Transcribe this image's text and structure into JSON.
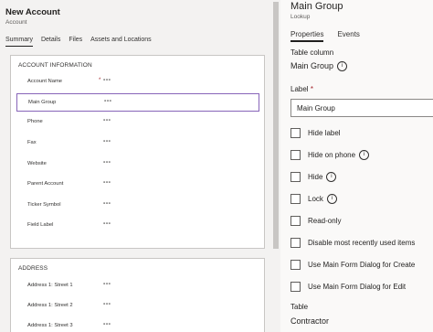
{
  "form": {
    "title": "New Account",
    "entity": "Account",
    "tabs": [
      "Summary",
      "Details",
      "Files",
      "Assets and Locations"
    ],
    "sections": [
      {
        "title": "ACCOUNT INFORMATION",
        "fields": [
          {
            "label": "Account Name",
            "required_mark": "*",
            "value": "---"
          },
          {
            "label": "Main Group",
            "value": "---"
          },
          {
            "label": "Phone",
            "value": "---"
          },
          {
            "label": "Fax",
            "value": "---"
          },
          {
            "label": "Website",
            "value": "---"
          },
          {
            "label": "Parent Account",
            "value": "---"
          },
          {
            "label": "Ticker Symbol",
            "value": "---"
          },
          {
            "label": "Field Label",
            "value": "---"
          }
        ]
      },
      {
        "title": "ADDRESS",
        "fields": [
          {
            "label": "Address 1: Street 1",
            "value": "---"
          },
          {
            "label": "Address 1: Street 2",
            "value": "---"
          },
          {
            "label": "Address 1: Street 3",
            "value": "---"
          }
        ]
      }
    ]
  },
  "pane": {
    "title": "Main Group",
    "subtitle": "Lookup",
    "tabs": [
      "Properties",
      "Events"
    ],
    "table_column_label": "Table column",
    "table_column_value": "Main Group",
    "label_label": "Label",
    "label_required": "*",
    "label_value": "Main Group",
    "checkboxes": [
      {
        "label": "Hide label",
        "info": false,
        "checked": false
      },
      {
        "label": "Hide on phone",
        "info": true,
        "checked": false
      },
      {
        "label": "Hide",
        "info": true,
        "checked": false
      },
      {
        "label": "Lock",
        "info": true,
        "checked": false
      },
      {
        "label": "Read-only",
        "info": false,
        "checked": false
      },
      {
        "label": "Disable most recently used items",
        "info": false,
        "checked": false
      },
      {
        "label": "Use Main Form Dialog for Create",
        "info": false,
        "checked": false
      },
      {
        "label": "Use Main Form Dialog for Edit",
        "info": false,
        "checked": false
      }
    ],
    "table_label": "Table",
    "table_value": "Contractor",
    "info_glyph": "i"
  }
}
